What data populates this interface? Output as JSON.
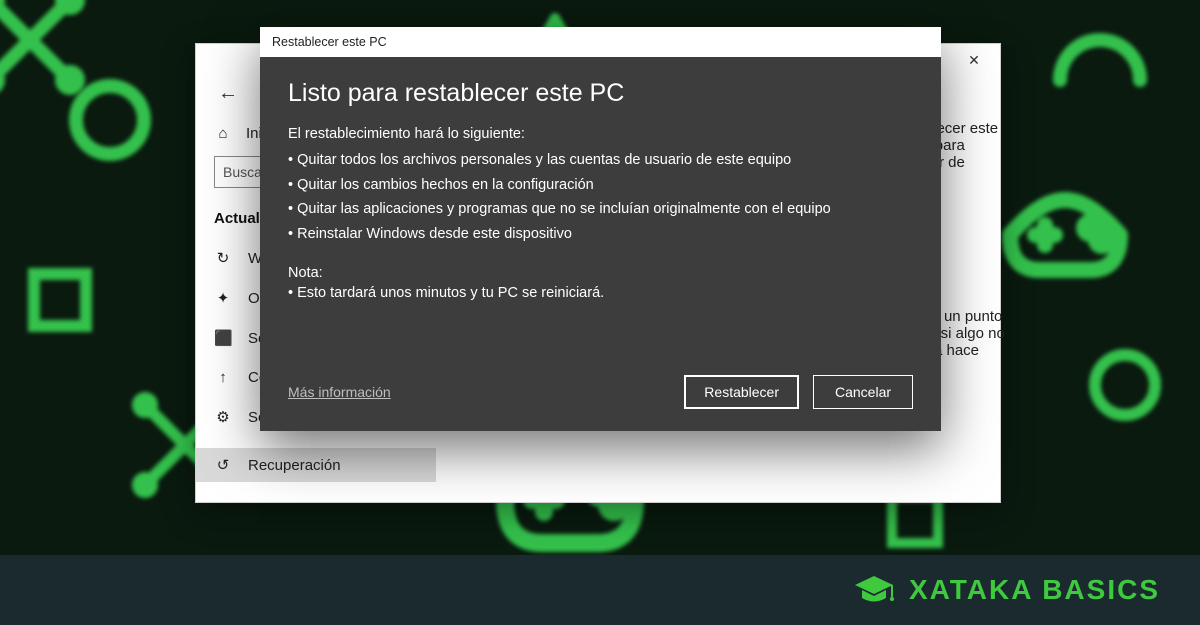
{
  "brand": {
    "text": "XATAKA BASICS"
  },
  "settings": {
    "back_icon": "←",
    "close_icon": "✕",
    "home_icon": "⌂",
    "home_label": "Inicio",
    "search_placeholder": "Buscar una opción",
    "section_label": "Actualización y seguridad",
    "nav": [
      {
        "icon": "↻",
        "label": "Windows Update"
      },
      {
        "icon": "✦",
        "label": "Optimización de distribución"
      },
      {
        "icon": "⬛",
        "label": "Seguridad de Windows"
      },
      {
        "icon": "↑",
        "label": "Copia de seguridad"
      },
      {
        "icon": "⚙",
        "label": "Solucionar problemas"
      },
      {
        "icon": "↺",
        "label": "Recuperación"
      }
    ],
    "right_top": "Restablecer este equipo para empezar de nuevo",
    "right_bottom": "Volver a un punto anterior si algo no funciona hace"
  },
  "modal": {
    "title": "Restablecer este PC",
    "heading": "Listo para restablecer este PC",
    "intro": "El restablecimiento hará lo siguiente:",
    "bullets": [
      " Quitar todos los archivos personales y las cuentas de usuario de este equipo",
      " Quitar los cambios hechos en la configuración",
      " Quitar las aplicaciones y programas que no se incluían originalmente con el equipo",
      "Reinstalar Windows desde este dispositivo"
    ],
    "note_label": "Nota:",
    "note_bullets": [
      "Esto tardará unos minutos y tu PC se reiniciará."
    ],
    "more_info": "Más información",
    "btn_primary": "Restablecer",
    "btn_secondary": "Cancelar"
  }
}
